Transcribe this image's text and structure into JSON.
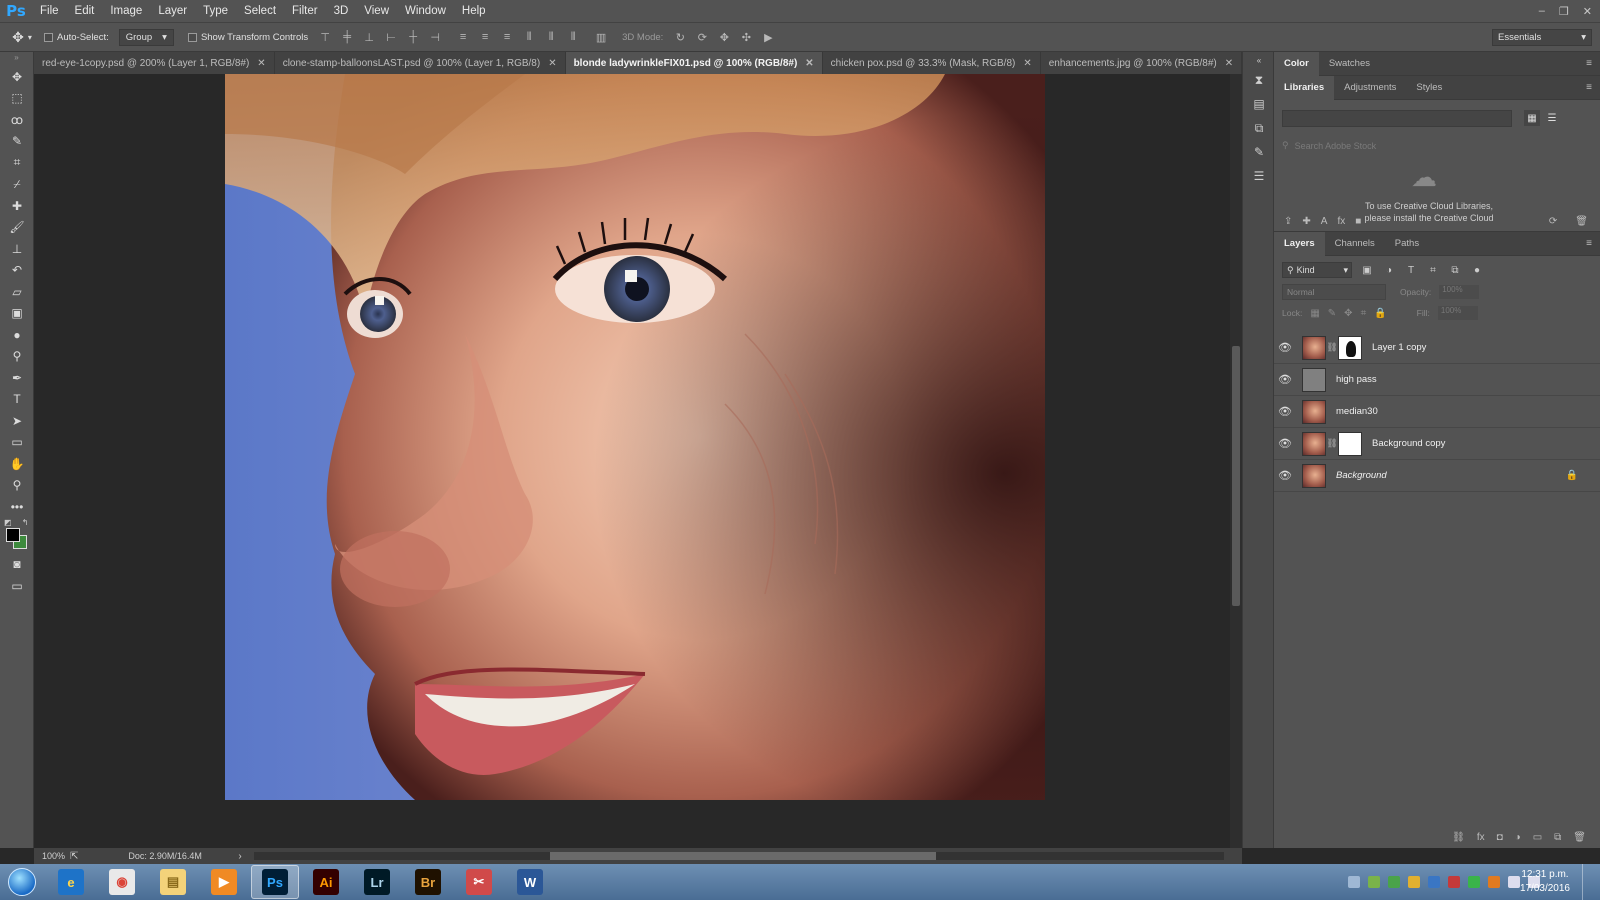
{
  "app": {
    "logo": "Ps"
  },
  "menu": [
    "File",
    "Edit",
    "Image",
    "Layer",
    "Type",
    "Select",
    "Filter",
    "3D",
    "View",
    "Window",
    "Help"
  ],
  "window_controls": [
    "–",
    "❐",
    "✕"
  ],
  "options": {
    "auto_select": "Auto-Select:",
    "group": "Group",
    "show_transform": "Show Transform Controls",
    "mode_3d": "3D Mode:",
    "workspace": "Essentials"
  },
  "tabs": [
    {
      "title": "red-eye-1copy.psd @ 200% (Layer 1, RGB/8#)",
      "active": false
    },
    {
      "title": "clone-stamp-balloonsLAST.psd @ 100% (Layer 1, RGB/8)",
      "active": false
    },
    {
      "title": "blonde ladywrinkleFIX01.psd @ 100% (RGB/8#)",
      "active": true
    },
    {
      "title": "chicken pox.psd @ 33.3% (Mask, RGB/8)",
      "active": false
    },
    {
      "title": "enhancements.jpg @ 100% (RGB/8#)",
      "active": false
    }
  ],
  "status": {
    "zoom": "100%",
    "doc": "Doc: 2.90M/16.4M"
  },
  "color_panel": {
    "tabs": [
      "Color",
      "Swatches"
    ]
  },
  "libraries_panel": {
    "tabs": [
      "Libraries",
      "Adjustments",
      "Styles"
    ],
    "search_placeholder": "Search Adobe Stock",
    "message_line1": "To use Creative Cloud Libraries,",
    "message_line2": "please install the Creative Cloud"
  },
  "layers_panel": {
    "tabs": [
      "Layers",
      "Channels",
      "Paths"
    ],
    "kind": "Kind",
    "blend_mode": "Normal",
    "opacity_label": "Opacity:",
    "opacity_value": "100%",
    "lock_label": "Lock:",
    "fill_label": "Fill:",
    "fill_value": "100%",
    "layers": [
      {
        "name": "Layer 1 copy",
        "thumb": "face",
        "mask": "dark",
        "locked": false,
        "italic": false
      },
      {
        "name": "high pass",
        "thumb": "gray",
        "mask": null,
        "locked": false,
        "italic": false
      },
      {
        "name": "median30",
        "thumb": "face",
        "mask": null,
        "locked": false,
        "italic": false
      },
      {
        "name": "Background copy",
        "thumb": "face",
        "mask": "white",
        "locked": false,
        "italic": false
      },
      {
        "name": "Background",
        "thumb": "face",
        "mask": null,
        "locked": true,
        "italic": true
      }
    ]
  },
  "taskbar": {
    "apps": [
      {
        "name": "internet-explorer",
        "label": "e",
        "bg": "#1e73c8",
        "fg": "#ffd54a"
      },
      {
        "name": "chrome",
        "label": "◉",
        "bg": "#e9e9e9",
        "fg": "#db4437"
      },
      {
        "name": "file-explorer",
        "label": "▤",
        "bg": "#f3d27a",
        "fg": "#8a6a1a"
      },
      {
        "name": "media-player",
        "label": "▶",
        "bg": "#f08a24",
        "fg": "#ffffff"
      },
      {
        "name": "photoshop",
        "label": "Ps",
        "bg": "#001e36",
        "fg": "#31a8ff"
      },
      {
        "name": "illustrator",
        "label": "Ai",
        "bg": "#330000",
        "fg": "#ff9a00"
      },
      {
        "name": "lightroom",
        "label": "Lr",
        "bg": "#001a26",
        "fg": "#add5ec"
      },
      {
        "name": "bridge",
        "label": "Br",
        "bg": "#1f1100",
        "fg": "#e8a33d"
      },
      {
        "name": "snipping-tool",
        "label": "✂",
        "bg": "#d04a4a",
        "fg": "#ffffff"
      },
      {
        "name": "word",
        "label": "W",
        "bg": "#2b5797",
        "fg": "#ffffff"
      }
    ],
    "time": "12:31 p.m.",
    "date": "17/03/2016"
  }
}
